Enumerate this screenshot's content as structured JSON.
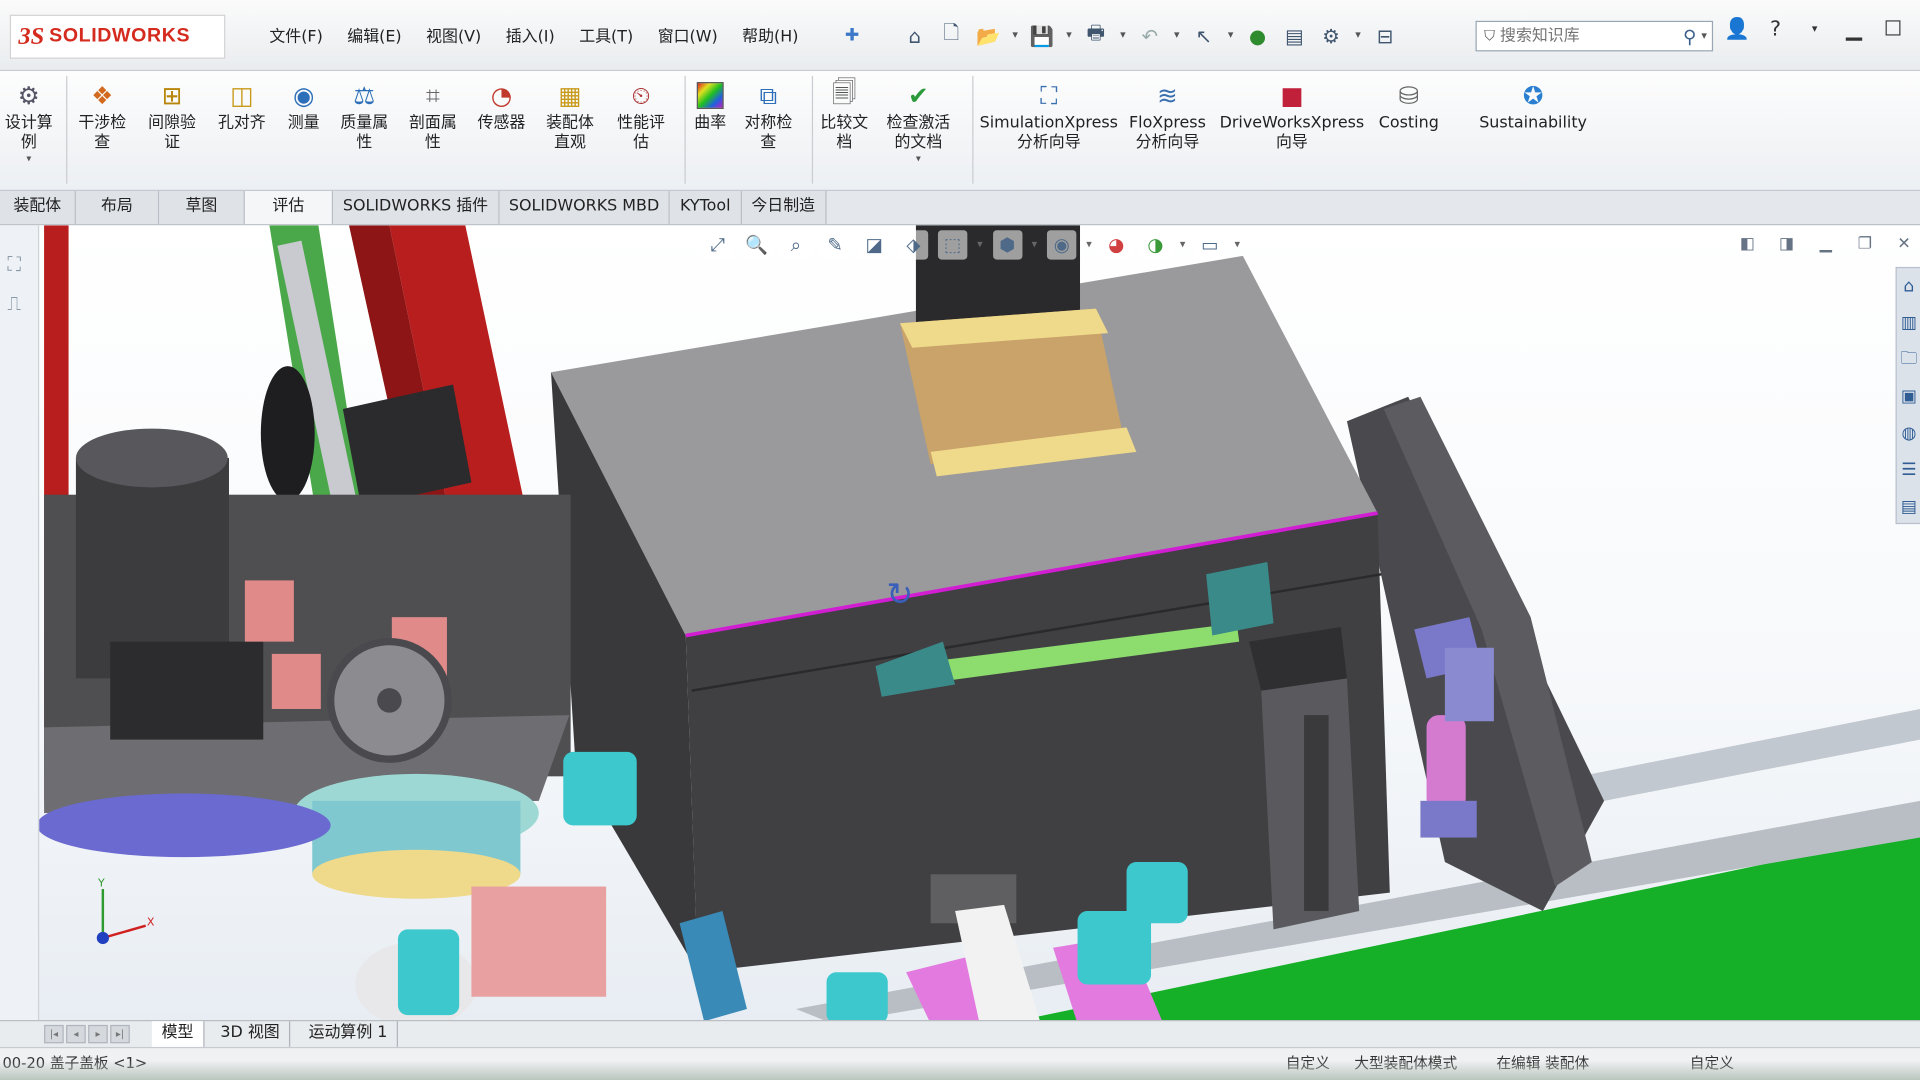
{
  "app": {
    "brand_prefix": "3S",
    "brand": "SOLIDWORKS"
  },
  "menu": [
    "文件(F)",
    "编辑(E)",
    "视图(V)",
    "插入(I)",
    "工具(T)",
    "窗口(W)",
    "帮助(H)"
  ],
  "search": {
    "placeholder": "搜索知识库"
  },
  "ribbon": {
    "design_study": "设计算\n例",
    "interference": "干涉检\n查",
    "clearance": "间隙验\n证",
    "hole_align": "孔对齐",
    "measure": "测量",
    "mass_props": "质量属\n性",
    "section_props": "剖面属\n性",
    "sensor": "传感器",
    "assembly_visual": "装配体\n直观",
    "performance": "性能评\n估",
    "curvature": "曲率",
    "symmetry": "对称检\n查",
    "compare": "比较文\n档",
    "check_active": "检查激活\n的文档",
    "simxpress": "SimulationXpress\n分析向导",
    "floxpress": "FloXpress\n分析向导",
    "driveworks": "DriveWorksXpress\n向导",
    "costing": "Costing",
    "sustainability": "Sustainability"
  },
  "tabs": [
    "装配体",
    "布局",
    "草图",
    "评估",
    "SOLIDWORKS 插件",
    "SOLIDWORKS MBD",
    "KYTool",
    "今日制造"
  ],
  "active_tab": "评估",
  "bottom_tabs": [
    "模型",
    "3D 视图",
    "运动算例 1"
  ],
  "status": {
    "left": "00-20 盖子盖板 <1>",
    "s1": "自定义",
    "s2": "大型装配体模式",
    "s3": "在编辑 装配体",
    "s4": "自定义"
  },
  "icons": {
    "quick": [
      "home-icon",
      "new-file-icon",
      "open-file-icon",
      "save-icon",
      "print-icon",
      "undo-icon",
      "select-icon",
      "traffic-light-icon",
      "file-properties-icon",
      "options-gear-icon"
    ],
    "heads_up": [
      "zoom-to-fit-icon",
      "zoom-to-area-icon",
      "previous-view-icon",
      "section-view-icon",
      "view-orientation-icon",
      "display-style-icon",
      "hide-show-icon",
      "edit-appearance-icon",
      "apply-scene-icon",
      "view-settings-icon"
    ],
    "task_pane": [
      "solidworks-resources-icon",
      "design-library-icon",
      "file-explorer-icon",
      "view-palette-icon",
      "appearances-icon",
      "custom-properties-icon",
      "forum-icon"
    ]
  },
  "colors": {
    "brand_red": "#d52b1e",
    "body_gray": "#3a3a3c",
    "top_gray": "#9c9c9c",
    "edge_magenta": "#d21ed2",
    "belt_green": "#16b028",
    "frame_red": "#b91e1e",
    "board_green": "#4ba84a"
  }
}
